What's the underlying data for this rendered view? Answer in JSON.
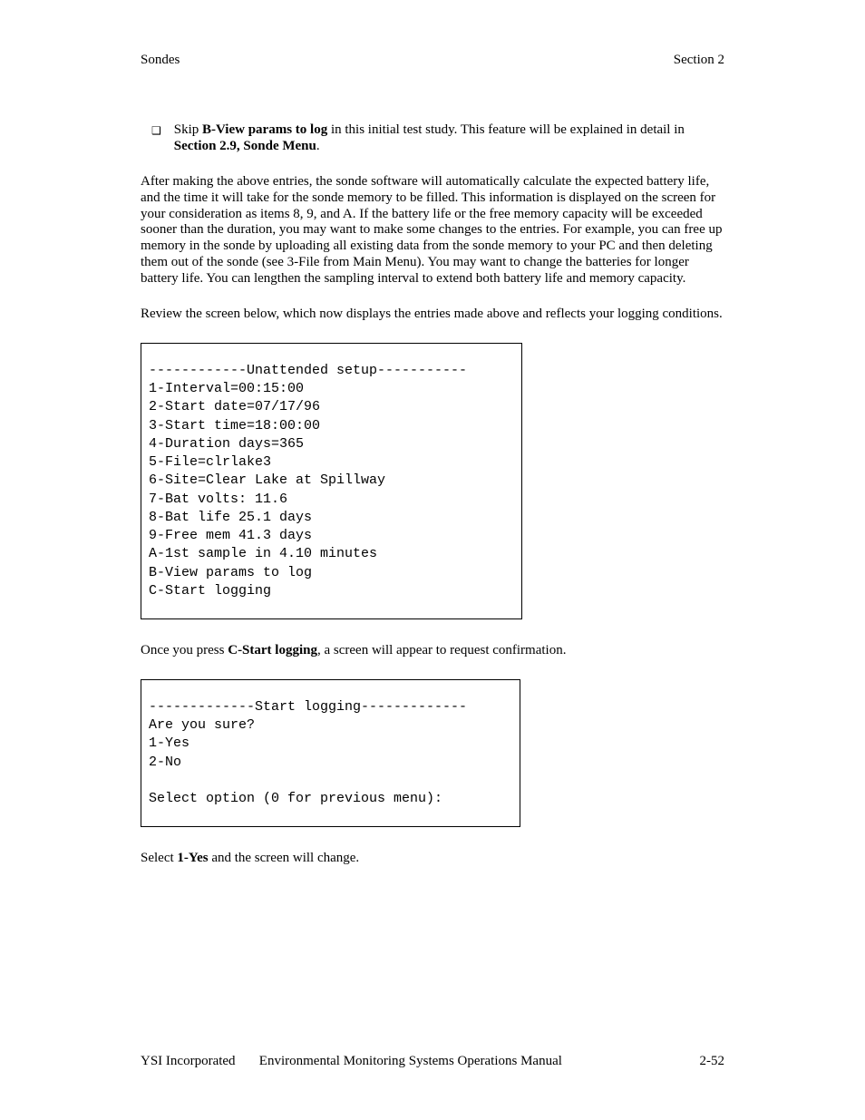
{
  "header": {
    "left": "Sondes",
    "right": "Section 2"
  },
  "bullet": {
    "pre": "Skip ",
    "bold1": "B-View params to log",
    "mid": " in this initial test study.  This feature will be explained in detail in ",
    "bold2": "Section 2.9, Sonde Menu",
    "post": "."
  },
  "para1": "After making the above entries, the sonde software will automatically calculate the expected battery life, and the time it will take for the sonde memory to be filled.  This information is displayed on the screen for your consideration as items 8, 9, and A.  If the battery life or the free memory capacity will be exceeded sooner than the duration, you may want to make some changes to the entries.  For example, you can free up memory in the sonde by uploading all existing data from the sonde memory to your PC and then deleting them out of the sonde (see 3-File from Main Menu).  You may want to change the batteries for longer battery life.  You can lengthen the sampling interval to extend both battery life and memory capacity.",
  "para2": "Review the screen below, which now displays the entries made above and reflects your logging conditions.",
  "screen1": "------------Unattended setup-----------\n1-Interval=00:15:00\n2-Start date=07/17/96\n3-Start time=18:00:00\n4-Duration days=365\n5-File=clrlake3\n6-Site=Clear Lake at Spillway\n7-Bat volts: 11.6\n8-Bat life 25.1 days\n9-Free mem 41.3 days\nA-1st sample in 4.10 minutes\nB-View params to log\nC-Start logging",
  "para3": {
    "pre": "Once you press ",
    "bold": "C-Start logging",
    "post": ", a screen will appear to request confirmation."
  },
  "screen2": "-------------Start logging-------------\nAre you sure?\n1-Yes\n2-No\n\nSelect option (0 for previous menu):",
  "para4": {
    "pre": "Select ",
    "bold": "1-Yes",
    "post": " and the screen will change."
  },
  "footer": {
    "left": "YSI Incorporated       Environmental Monitoring Systems Operations Manual",
    "right": "2-52"
  }
}
